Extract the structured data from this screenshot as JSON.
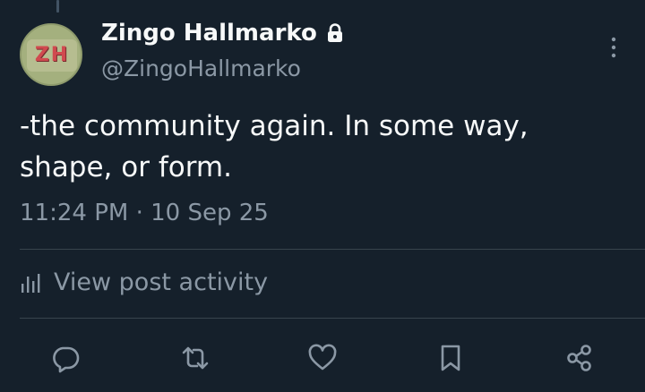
{
  "post": {
    "avatar_text": "ZH",
    "display_name": "Zingo Hallmarko",
    "handle": "@ZingoHallmarko",
    "text_line1": "-the community again. In some way,",
    "text_line2": "shape, or form.",
    "timestamp": "11:24 PM · 10 Sep 25"
  },
  "activity": {
    "label": "View post activity"
  },
  "actions": [
    "reply-icon",
    "repost-icon",
    "like-icon",
    "bookmark-icon",
    "share-icon"
  ],
  "colors": {
    "background": "#15202b",
    "primary_text": "#f7f9f9",
    "secondary_text": "#8b98a5",
    "divider": "#38444d"
  }
}
